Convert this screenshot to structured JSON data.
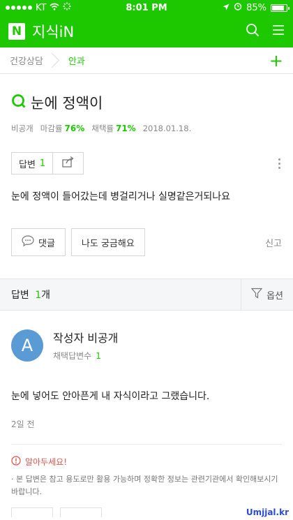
{
  "status_bar": {
    "carrier": "KT",
    "time": "8:01 PM",
    "battery": "85%",
    "battery_level": 0.85
  },
  "header": {
    "logo": "N",
    "brand": "지식iN",
    "icons": [
      "search-icon",
      "menu-icon"
    ]
  },
  "breadcrumb": {
    "parent": "건강상담",
    "current": "안과",
    "add_icon": "+"
  },
  "question": {
    "title": "눈에 정액이",
    "visibility": "비공개",
    "closing_rate_label": "마감률",
    "closing_rate": "76%",
    "adoption_rate_label": "채택률",
    "adoption_rate": "71%",
    "date": "2018.01.18.",
    "answer_button_label": "답변",
    "answer_count": "1",
    "body": "눈에 정액이 들어갔는데 병걸리거나 실명같은거되나요",
    "comment_button": "댓글",
    "curious_button": "나도 궁금해요",
    "report": "신고"
  },
  "answers_header": {
    "label": "답변",
    "count": "1",
    "unit": "개",
    "options": "옵션"
  },
  "answer": {
    "avatar_letter": "A",
    "author": "작성자 비공개",
    "adopted_label": "채택답변수",
    "adopted_count": "1",
    "body": "눈에 넣어도 안아픈게 내 자식이라고 그랬습니다.",
    "time": "2일 전",
    "notice_title": "알아두세요!",
    "notice_text": "· 본 답변은 참고 용도로만 활용 가능하며 정확한 정보는 관련기관에서 확인해보시기 바랍니다."
  },
  "watermark": "Umjjal.kr",
  "colors": {
    "brand_green": "#1ec800",
    "avatar_blue": "#5b9bd5",
    "notice_red": "#e0574c"
  }
}
